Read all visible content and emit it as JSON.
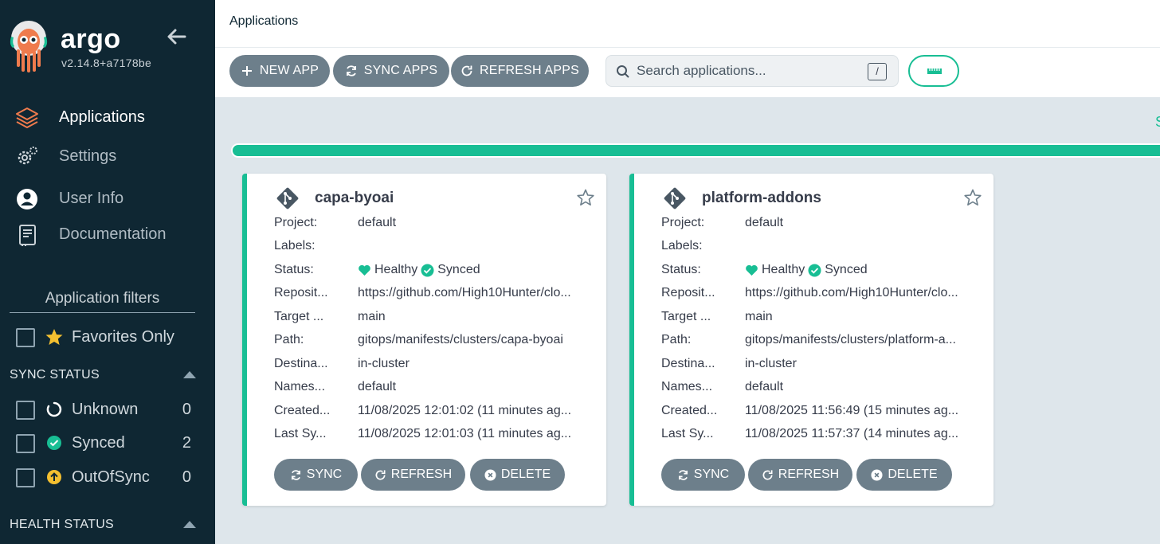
{
  "brand": {
    "name": "argo",
    "version": "v2.14.8+a7178be"
  },
  "sidebar": {
    "nav": [
      {
        "label": "Applications"
      },
      {
        "label": "Settings"
      },
      {
        "label": "User Info"
      },
      {
        "label": "Documentation"
      }
    ],
    "filters_title": "Application filters",
    "favorites_label": "Favorites Only",
    "sync_status": {
      "title": "SYNC STATUS",
      "items": [
        {
          "label": "Unknown",
          "count": "0"
        },
        {
          "label": "Synced",
          "count": "2"
        },
        {
          "label": "OutOfSync",
          "count": "0"
        }
      ]
    },
    "health_status": {
      "title": "HEALTH STATUS"
    }
  },
  "header": {
    "title": "Applications"
  },
  "toolbar": {
    "new_app": "NEW APP",
    "sync_apps": "SYNC APPS",
    "refresh_apps": "REFRESH APPS",
    "search_placeholder": "Search applications...",
    "search_shortcut": "/"
  },
  "edge_text": "S",
  "colors": {
    "accent": "#18be94",
    "sidebar": "#0f2733",
    "button": "#6d7f8b",
    "warning": "#f4c030"
  },
  "labels": {
    "project": "Project:",
    "labels": "Labels:",
    "status": "Status:",
    "repository": "Reposit...",
    "target": "Target ...",
    "path": "Path:",
    "destination": "Destina...",
    "namespace": "Names...",
    "created": "Created...",
    "last_sync": "Last Sy..."
  },
  "apps": [
    {
      "name": "capa-byoai",
      "project": "default",
      "labels": "",
      "health": "Healthy",
      "sync": "Synced",
      "repository": "https://github.com/High10Hunter/clo...",
      "target": "main",
      "path": "gitops/manifests/clusters/capa-byoai",
      "destination": "in-cluster",
      "namespace": "default",
      "created": "11/08/2025 12:01:02  (11 minutes ag...",
      "last_sync": "11/08/2025 12:01:03  (11 minutes ag...",
      "actions": {
        "sync": "SYNC",
        "refresh": "REFRESH",
        "delete": "DELETE"
      }
    },
    {
      "name": "platform-addons",
      "project": "default",
      "labels": "",
      "health": "Healthy",
      "sync": "Synced",
      "repository": "https://github.com/High10Hunter/clo...",
      "target": "main",
      "path": "gitops/manifests/clusters/platform-a...",
      "destination": "in-cluster",
      "namespace": "default",
      "created": "11/08/2025 11:56:49  (15 minutes ag...",
      "last_sync": "11/08/2025 11:57:37  (14 minutes ag...",
      "actions": {
        "sync": "SYNC",
        "refresh": "REFRESH",
        "delete": "DELETE"
      }
    }
  ]
}
